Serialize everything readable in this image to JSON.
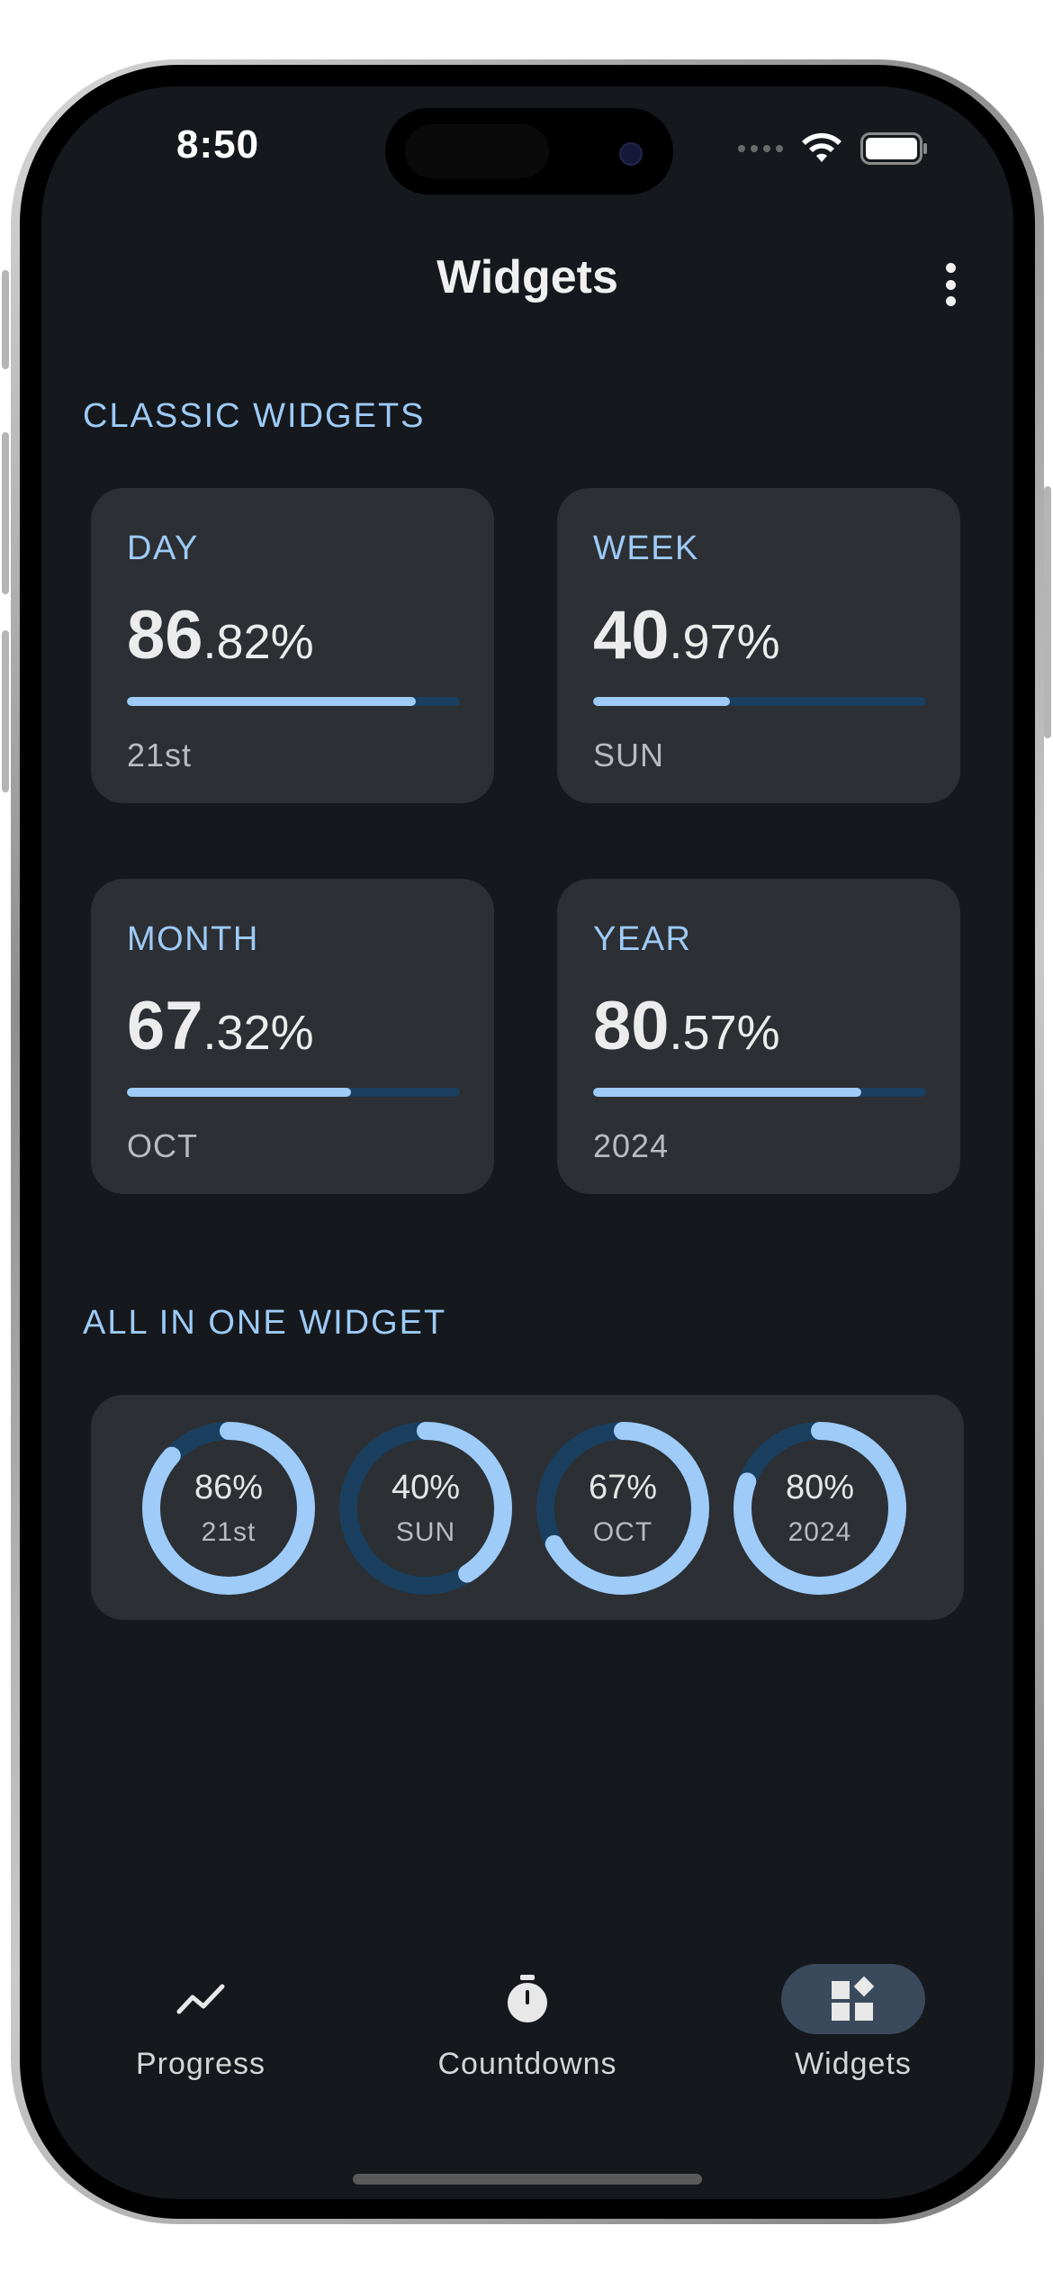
{
  "status_bar": {
    "time": "8:50"
  },
  "app_bar": {
    "title": "Widgets"
  },
  "classic_section": {
    "label": "CLASSIC WIDGETS",
    "cards": [
      {
        "title": "DAY",
        "int": "86",
        "dec": ".82",
        "pct_sign": "%",
        "progress": 0.8682,
        "sub": "21st"
      },
      {
        "title": "WEEK",
        "int": "40",
        "dec": ".97",
        "pct_sign": "%",
        "progress": 0.4097,
        "sub": "SUN"
      },
      {
        "title": "MONTH",
        "int": "67",
        "dec": ".32",
        "pct_sign": "%",
        "progress": 0.6732,
        "sub": "OCT"
      },
      {
        "title": "YEAR",
        "int": "80",
        "dec": ".57",
        "pct_sign": "%",
        "progress": 0.8057,
        "sub": "2024"
      }
    ]
  },
  "all_in_one_section": {
    "label": "ALL IN ONE WIDGET",
    "rings": [
      {
        "pct": "86%",
        "sub": "21st",
        "progress": 0.8682
      },
      {
        "pct": "40%",
        "sub": "SUN",
        "progress": 0.4097
      },
      {
        "pct": "67%",
        "sub": "OCT",
        "progress": 0.6732
      },
      {
        "pct": "80%",
        "sub": "2024",
        "progress": 0.8057
      }
    ]
  },
  "bottom_nav": {
    "items": [
      {
        "label": "Progress",
        "icon": "trending-line-icon",
        "active": false
      },
      {
        "label": "Countdowns",
        "icon": "stopwatch-icon",
        "active": false
      },
      {
        "label": "Widgets",
        "icon": "widgets-icon",
        "active": true
      }
    ]
  },
  "colors": {
    "background": "#15181c",
    "card": "#2c2f33",
    "accent": "#9ecbf7",
    "track": "#1b3f5e",
    "active_nav_pill": "#3a4a5c"
  }
}
